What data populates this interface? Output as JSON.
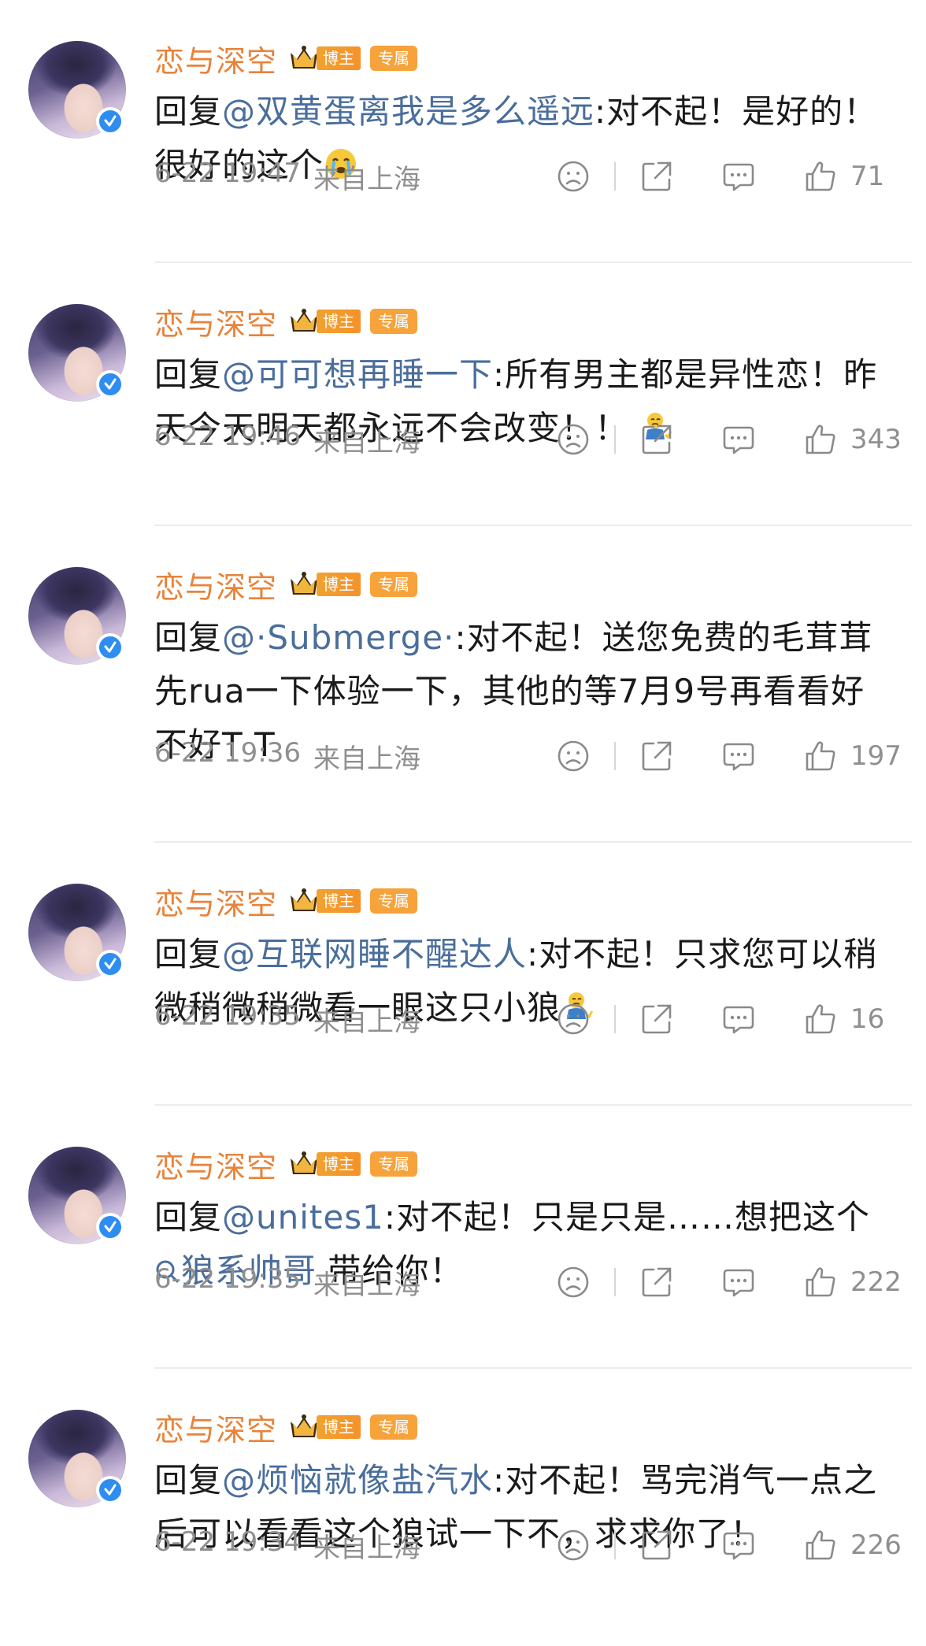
{
  "comments": [
    {
      "username": "恋与深空",
      "badge_blogger": "博主",
      "badge_exclusive": "专属",
      "reply_prefix": "回复",
      "mention": "@双黄蛋离我是多么遥远",
      "text": ":对不起！是好的！很好的这个",
      "emoji": "crying-face-emoji",
      "date": "6-22 19:47",
      "location": "来自上海",
      "likes": "71"
    },
    {
      "username": "恋与深空",
      "badge_blogger": "博主",
      "badge_exclusive": "专属",
      "reply_prefix": "回复",
      "mention": "@可可想再睡一下",
      "text": ":所有男主都是异性恋！昨天今天明天都永远不会改变！！",
      "emoji": "sad-kneeling-emoji",
      "date": "6-22 19:46",
      "location": "来自上海",
      "likes": "343"
    },
    {
      "username": "恋与深空",
      "badge_blogger": "博主",
      "badge_exclusive": "专属",
      "reply_prefix": "回复",
      "mention": "@·Submerge·",
      "text": ":对不起！送您免费的毛茸茸先rua一下体验一下，其他的等7月9号再看看好不好T T",
      "date": "6-22 19:36",
      "location": "来自上海",
      "likes": "197"
    },
    {
      "username": "恋与深空",
      "badge_blogger": "博主",
      "badge_exclusive": "专属",
      "reply_prefix": "回复",
      "mention": "@互联网睡不醒达人",
      "text": ":对不起！只求您可以稍微稍微稍微看一眼这只小狼",
      "emoji": "sad-kneeling-emoji",
      "date": "6-22 19:35",
      "location": "来自上海",
      "likes": "16"
    },
    {
      "username": "恋与深空",
      "badge_blogger": "博主",
      "badge_exclusive": "专属",
      "reply_prefix": "回复",
      "mention": "@unites1",
      "text": ":对不起！只是只是……想把这个",
      "topic": "狼系帅哥",
      "text_after": " 带给你！",
      "date": "6-22 19:35",
      "location": "来自上海",
      "likes": "222"
    },
    {
      "username": "恋与深空",
      "badge_blogger": "博主",
      "badge_exclusive": "专属",
      "reply_prefix": "回复",
      "mention": "@烦恼就像盐汽水",
      "text": ":对不起！骂完消气一点之后可以看看这个狼试一下不，求求你了！",
      "date": "6-22 19:34",
      "location": "来自上海",
      "likes": "226"
    }
  ],
  "colors": {
    "username": "#e8833a",
    "mention": "#4a6e9c",
    "meta": "#8f8f8f",
    "badge": "#f6a33b",
    "verify": "#2e8df0"
  }
}
